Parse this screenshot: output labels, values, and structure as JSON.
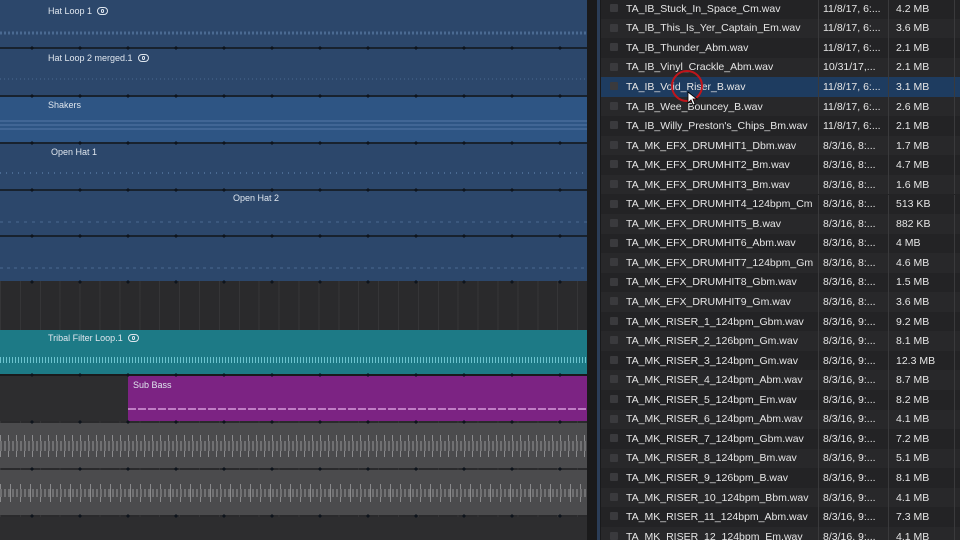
{
  "colors": {
    "blue_region": "#2c476b",
    "blue_region_sel": "#2e5584",
    "teal_region": "#1d7a86",
    "purple_region": "#7c2383",
    "gray_region": "#4b4b4d",
    "selected_row": "#1e3c60"
  },
  "tracks": [
    {
      "name": "Hat Loop 1",
      "loop_icon": true
    },
    {
      "name": "Hat Loop 2 merged.1",
      "loop_icon": true
    },
    {
      "name": "Shakers",
      "loop_icon": false
    },
    {
      "name": "Open Hat 1",
      "loop_icon": false
    },
    {
      "name": "Open Hat 2",
      "loop_icon": false
    },
    {
      "name": "",
      "loop_icon": false
    },
    {
      "name": "Tribal Filter Loop.1",
      "loop_icon": true
    },
    {
      "name": "Sub Bass",
      "loop_icon": false
    }
  ],
  "files": [
    {
      "name": "TA_IB_Stuck_In_Space_Cm.wav",
      "date": "11/8/17, 6:...",
      "size": "4.2 MB"
    },
    {
      "name": "TA_IB_This_Is_Yer_Captain_Em.wav",
      "date": "11/8/17, 6:...",
      "size": "3.6 MB"
    },
    {
      "name": "TA_IB_Thunder_Abm.wav",
      "date": "11/8/17, 6:...",
      "size": "2.1 MB"
    },
    {
      "name": "TA_IB_Vinyl_Crackle_Abm.wav",
      "date": "10/31/17,...",
      "size": "2.1 MB"
    },
    {
      "name": "TA_IB_Void_Riser_B.wav",
      "date": "11/8/17, 6:...",
      "size": "3.1 MB",
      "selected": true
    },
    {
      "name": "TA_IB_Wee_Bouncey_B.wav",
      "date": "11/8/17, 6:...",
      "size": "2.6 MB"
    },
    {
      "name": "TA_IB_Willy_Preston's_Chips_Bm.wav",
      "date": "11/8/17, 6:...",
      "size": "2.1 MB"
    },
    {
      "name": "TA_MK_EFX_DRUMHIT1_Dbm.wav",
      "date": "8/3/16, 8:...",
      "size": "1.7 MB"
    },
    {
      "name": "TA_MK_EFX_DRUMHIT2_Bm.wav",
      "date": "8/3/16, 8:...",
      "size": "4.7 MB"
    },
    {
      "name": "TA_MK_EFX_DRUMHIT3_Bm.wav",
      "date": "8/3/16, 8:...",
      "size": "1.6 MB"
    },
    {
      "name": "TA_MK_EFX_DRUMHIT4_124bpm_Cm",
      "date": "8/3/16, 8:...",
      "size": "513 KB"
    },
    {
      "name": "TA_MK_EFX_DRUMHIT5_B.wav",
      "date": "8/3/16, 8:...",
      "size": "882 KB"
    },
    {
      "name": "TA_MK_EFX_DRUMHIT6_Abm.wav",
      "date": "8/3/16, 8:...",
      "size": "4 MB"
    },
    {
      "name": "TA_MK_EFX_DRUMHIT7_124bpm_Gm",
      "date": "8/3/16, 8:...",
      "size": "4.6 MB"
    },
    {
      "name": "TA_MK_EFX_DRUMHIT8_Gbm.wav",
      "date": "8/3/16, 8:...",
      "size": "1.5 MB"
    },
    {
      "name": "TA_MK_EFX_DRUMHIT9_Gm.wav",
      "date": "8/3/16, 8:...",
      "size": "3.6 MB"
    },
    {
      "name": "TA_MK_RISER_1_124bpm_Gbm.wav",
      "date": "8/3/16, 9:...",
      "size": "9.2 MB"
    },
    {
      "name": "TA_MK_RISER_2_126bpm_Gm.wav",
      "date": "8/3/16, 9:...",
      "size": "8.1 MB"
    },
    {
      "name": "TA_MK_RISER_3_124bpm_Gm.wav",
      "date": "8/3/16, 9:...",
      "size": "12.3 MB"
    },
    {
      "name": "TA_MK_RISER_4_124bpm_Abm.wav",
      "date": "8/3/16, 9:...",
      "size": "8.7 MB"
    },
    {
      "name": "TA_MK_RISER_5_124bpm_Em.wav",
      "date": "8/3/16, 9:...",
      "size": "8.2 MB"
    },
    {
      "name": "TA_MK_RISER_6_124bpm_Abm.wav",
      "date": "8/3/16, 9:...",
      "size": "4.1 MB"
    },
    {
      "name": "TA_MK_RISER_7_124bpm_Gbm.wav",
      "date": "8/3/16, 9:...",
      "size": "7.2 MB"
    },
    {
      "name": "TA_MK_RISER_8_124bpm_Bm.wav",
      "date": "8/3/16, 9:...",
      "size": "5.1 MB"
    },
    {
      "name": "TA_MK_RISER_9_126bpm_B.wav",
      "date": "8/3/16, 9:...",
      "size": "8.1 MB"
    },
    {
      "name": "TA_MK_RISER_10_124bpm_Bbm.wav",
      "date": "8/3/16, 9:...",
      "size": "4.1 MB"
    },
    {
      "name": "TA_MK_RISER_11_124bpm_Abm.wav",
      "date": "8/3/16, 9:...",
      "size": "7.3 MB"
    },
    {
      "name": "TA_MK_RISER_12_124bpm_Em.wav",
      "date": "8/3/16, 9:...",
      "size": "4.1 MB"
    }
  ]
}
